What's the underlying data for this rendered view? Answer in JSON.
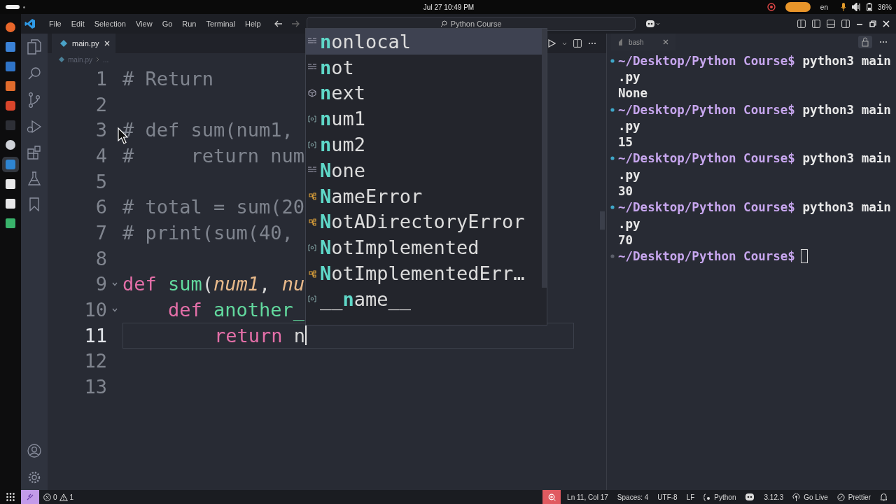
{
  "system_bar": {
    "datetime": "Jul 27 10:49 PM",
    "language": "en",
    "battery": "36%"
  },
  "menu": [
    "File",
    "Edit",
    "Selection",
    "View",
    "Go",
    "Run",
    "Terminal",
    "Help"
  ],
  "command_center": {
    "text": "Python Course"
  },
  "editor": {
    "tab": {
      "label": "main.py",
      "selected": true
    },
    "breadcrumb": [
      "main.py",
      "..."
    ],
    "lines": [
      {
        "number": "1",
        "current": false,
        "fold": false,
        "tokens": [
          {
            "kind": "comment",
            "text": "# Return"
          }
        ]
      },
      {
        "number": "2",
        "current": false,
        "fold": false
      },
      {
        "number": "3",
        "current": false,
        "fold": false,
        "tokens": [
          {
            "kind": "comment",
            "text": "# def sum(num1,"
          }
        ]
      },
      {
        "number": "4",
        "current": false,
        "fold": false,
        "tokens": [
          {
            "kind": "comment",
            "text": "#     return num"
          }
        ]
      },
      {
        "number": "5",
        "current": false,
        "fold": false
      },
      {
        "number": "6",
        "current": false,
        "fold": false,
        "tokens": [
          {
            "kind": "comment",
            "text": "# total = sum(20"
          }
        ]
      },
      {
        "number": "7",
        "current": false,
        "fold": false,
        "tokens": [
          {
            "kind": "comment",
            "text": "# print(sum(40,"
          }
        ]
      },
      {
        "number": "8",
        "current": false,
        "fold": false
      },
      {
        "number": "9",
        "current": false,
        "fold": true,
        "tokens": [
          {
            "kind": "keyword",
            "text": "def "
          },
          {
            "kind": "function",
            "text": "sum"
          },
          {
            "kind": "plain",
            "text": "("
          },
          {
            "kind": "param",
            "text": "num1"
          },
          {
            "kind": "plain",
            "text": ", "
          },
          {
            "kind": "param",
            "text": "nu"
          }
        ]
      },
      {
        "number": "10",
        "current": false,
        "fold": true,
        "tokens": [
          {
            "kind": "keyword",
            "text": "    def "
          },
          {
            "kind": "function",
            "text": "another_"
          }
        ]
      },
      {
        "number": "11",
        "current": true,
        "fold": false,
        "tokens": [
          {
            "kind": "keyword",
            "text": "        return"
          },
          {
            "kind": "plain",
            "text": " n"
          }
        ]
      },
      {
        "number": "12",
        "current": false,
        "fold": false
      },
      {
        "number": "13",
        "current": false,
        "fold": false
      }
    ]
  },
  "suggestions": [
    {
      "label": "**n**onlocal",
      "kind": "keyword",
      "selected": true
    },
    {
      "label": "**n**ot",
      "kind": "keyword",
      "selected": false
    },
    {
      "label": "**n**ext",
      "kind": "function",
      "selected": false
    },
    {
      "label": "**n**um1",
      "kind": "variable",
      "selected": false
    },
    {
      "label": "**n**um2",
      "kind": "variable",
      "selected": false
    },
    {
      "label": "**N**one",
      "kind": "keyword",
      "selected": false
    },
    {
      "label": "**N**ameError",
      "kind": "class",
      "selected": false
    },
    {
      "label": "**N**otADirectoryError",
      "kind": "class",
      "selected": false
    },
    {
      "label": "**N**otImplemented",
      "kind": "variable",
      "selected": false
    },
    {
      "label": "**N**otImplementedErr…",
      "kind": "class",
      "selected": false
    },
    {
      "label": "__**n**ame__",
      "kind": "variable",
      "selected": false
    }
  ],
  "terminal": {
    "tab": {
      "label": "bash",
      "selected": true
    },
    "lines": [
      {
        "kind": "command",
        "prompt": "~/Desktop/Python Course$",
        "command": "python3 main"
      },
      {
        "kind": "output",
        "text": ".py"
      },
      {
        "kind": "output",
        "text": "None"
      },
      {
        "kind": "command",
        "prompt": "~/Desktop/Python Course$",
        "command": "python3 main"
      },
      {
        "kind": "output",
        "text": ".py"
      },
      {
        "kind": "output",
        "text": "15"
      },
      {
        "kind": "command",
        "prompt": "~/Desktop/Python Course$",
        "command": "python3 main"
      },
      {
        "kind": "output",
        "text": ".py"
      },
      {
        "kind": "output",
        "text": "30"
      },
      {
        "kind": "command",
        "prompt": "~/Desktop/Python Course$",
        "command": "python3 main"
      },
      {
        "kind": "output",
        "text": ".py"
      },
      {
        "kind": "output",
        "text": "70"
      },
      {
        "kind": "prompt",
        "prompt": "~/Desktop/Python Course$"
      }
    ]
  },
  "status_bar": {
    "errors": "0",
    "warnings": "1",
    "right": [
      {
        "kind": "zoom"
      },
      {
        "kind": "text",
        "text": "Ln 11, Col 17"
      },
      {
        "kind": "text",
        "text": "Spaces: 4"
      },
      {
        "kind": "text",
        "text": "UTF-8"
      },
      {
        "kind": "text",
        "text": "LF"
      },
      {
        "kind": "language",
        "text": "Python"
      },
      {
        "kind": "copilot"
      },
      {
        "kind": "text",
        "text": "3.12.3"
      },
      {
        "kind": "golive",
        "text": "Go Live"
      },
      {
        "kind": "prettier",
        "text": "Prettier"
      },
      {
        "kind": "bell"
      }
    ]
  }
}
